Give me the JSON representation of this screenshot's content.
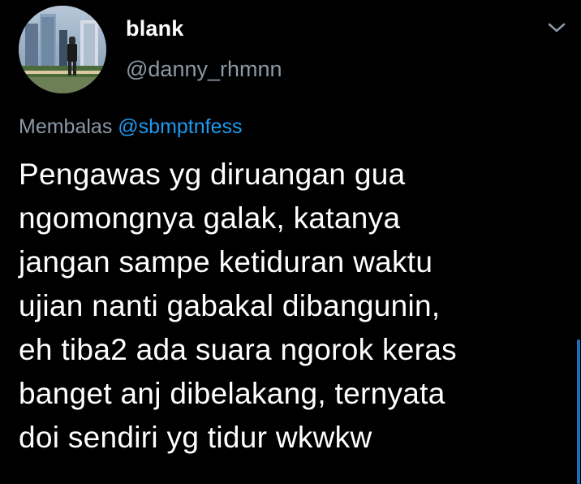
{
  "tweet": {
    "display_name": "blank",
    "handle": "@danny_rhmnn",
    "reply_prefix": "Membalas",
    "reply_mention": "@sbmptnfess",
    "text": "Pengawas yg diruangan gua\nngomongnya galak, katanya\njangan sampe ketiduran waktu\nujian nanti gabakal dibangunin,\neh tiba2 ada suara ngorok keras\nbanget anj dibelakang, ternyata\ndoi sendiri yg tidur wkwkw"
  },
  "icons": {
    "avatar": "profile-photo",
    "menu": "chevron-down-icon"
  },
  "colors": {
    "background": "#000000",
    "primary_text": "#ffffff",
    "secondary_text": "#8b98a5",
    "accent": "#1d9bf0"
  }
}
